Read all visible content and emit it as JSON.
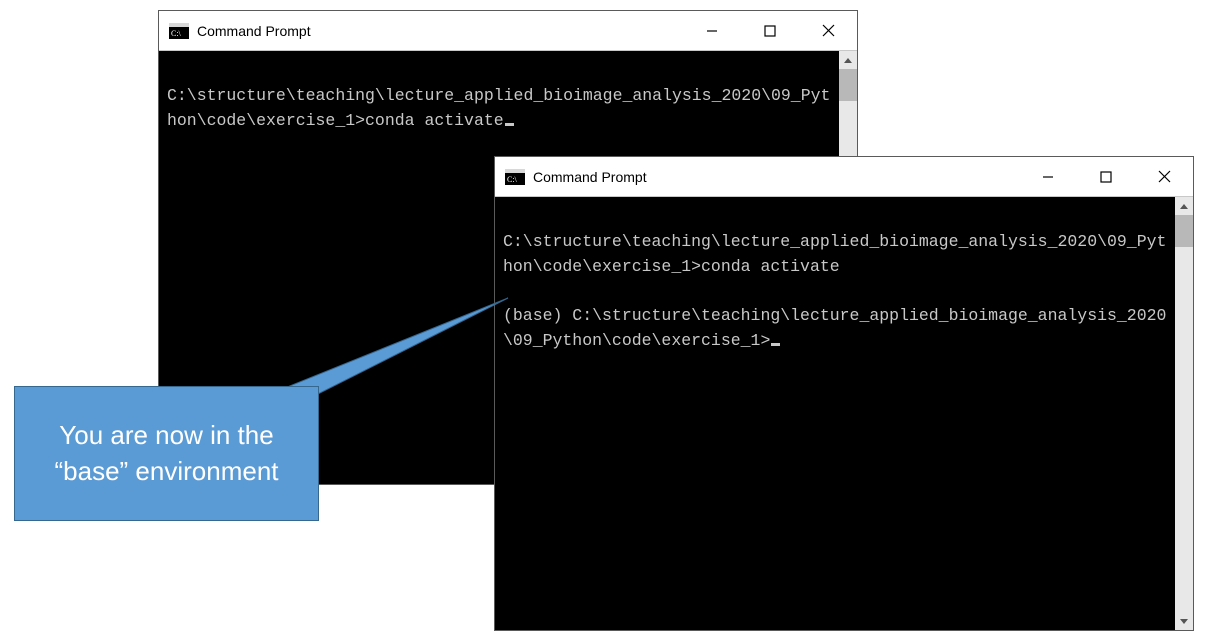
{
  "window1": {
    "title": "Command Prompt",
    "terminal_lines": "\nC:\\structure\\teaching\\lecture_applied_bioimage_analysis_2020\\09_Python\\code\\exercise_1>conda activate"
  },
  "window2": {
    "title": "Command Prompt",
    "terminal_lines": "\nC:\\structure\\teaching\\lecture_applied_bioimage_analysis_2020\\09_Python\\code\\exercise_1>conda activate\n\n(base) C:\\structure\\teaching\\lecture_applied_bioimage_analysis_2020\\09_Python\\code\\exercise_1>"
  },
  "callout": {
    "text": "You are now in the “base” environment"
  }
}
